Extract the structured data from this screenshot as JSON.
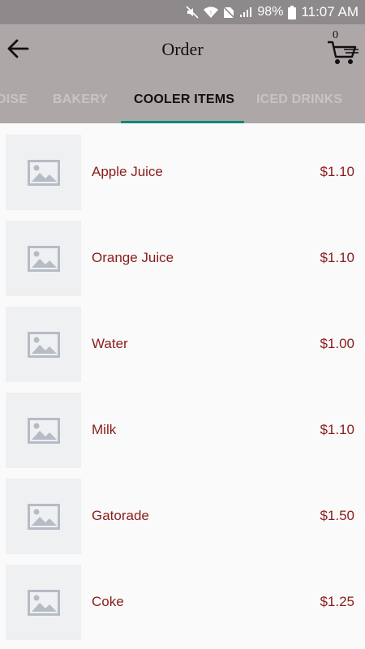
{
  "status_bar": {
    "battery": "98%",
    "time": "11:07 AM",
    "icons": [
      "mute-icon",
      "wifi-icon",
      "no-sim-icon",
      "signal-icon",
      "battery-icon"
    ]
  },
  "header": {
    "title": "Order",
    "cart_count": "0",
    "icons": [
      "back-arrow-icon",
      "cart-icon"
    ]
  },
  "tabs": [
    {
      "label": "DISE",
      "active": false
    },
    {
      "label": "BAKERY",
      "active": false
    },
    {
      "label": "COOLER ITEMS",
      "active": true
    },
    {
      "label": "ICED DRINKS",
      "active": false
    }
  ],
  "colors": {
    "app_bar": "#aea7a8",
    "status_bar": "#8e8a8b",
    "accent": "#0f8a74",
    "item_text": "#8b1c1c"
  },
  "items": [
    {
      "name": "Apple Juice",
      "price": "$1.10"
    },
    {
      "name": "Orange Juice",
      "price": "$1.10"
    },
    {
      "name": "Water",
      "price": "$1.00"
    },
    {
      "name": "Milk",
      "price": "$1.10"
    },
    {
      "name": "Gatorade",
      "price": "$1.50"
    },
    {
      "name": "Coke",
      "price": "$1.25"
    }
  ]
}
